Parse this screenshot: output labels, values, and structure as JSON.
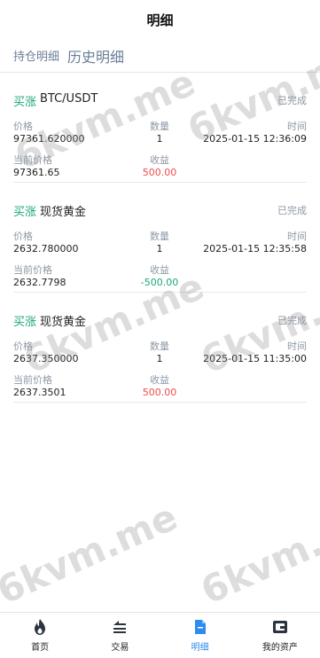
{
  "header": {
    "title": "明细"
  },
  "subtabs": {
    "holding": "持仓明细",
    "history": "历史明细"
  },
  "labels": {
    "price": "价格",
    "quantity": "数量",
    "time": "时间",
    "current_price": "当前价格",
    "profit": "收益"
  },
  "orders": [
    {
      "side": "买涨",
      "symbol": "BTC/USDT",
      "status": "已完成",
      "price": "97361.620000",
      "quantity": "1",
      "time": "2025-01-15 12:36:09",
      "current_price": "97361.65",
      "profit": "500.00",
      "profit_sign": "positive"
    },
    {
      "side": "买涨",
      "symbol": "现货黄金",
      "status": "已完成",
      "price": "2632.780000",
      "quantity": "1",
      "time": "2025-01-15 12:35:58",
      "current_price": "2632.7798",
      "profit": "-500.00",
      "profit_sign": "negative"
    },
    {
      "side": "买涨",
      "symbol": "现货黄金",
      "status": "已完成",
      "price": "2637.350000",
      "quantity": "1",
      "time": "2025-01-15 11:35:00",
      "current_price": "2637.3501",
      "profit": "500.00",
      "profit_sign": "positive"
    }
  ],
  "watermark": "6kvm.me",
  "nav": [
    {
      "label": "首页",
      "icon": "flame-icon"
    },
    {
      "label": "交易",
      "icon": "trade-icon"
    },
    {
      "label": "明细",
      "icon": "document-icon",
      "active": true
    },
    {
      "label": "我的资产",
      "icon": "wallet-icon"
    }
  ],
  "colors": {
    "accent": "#2d8cf0",
    "buy_green": "#1aa67a",
    "profit_red": "#ee4b4b",
    "muted": "#8e98a6"
  }
}
